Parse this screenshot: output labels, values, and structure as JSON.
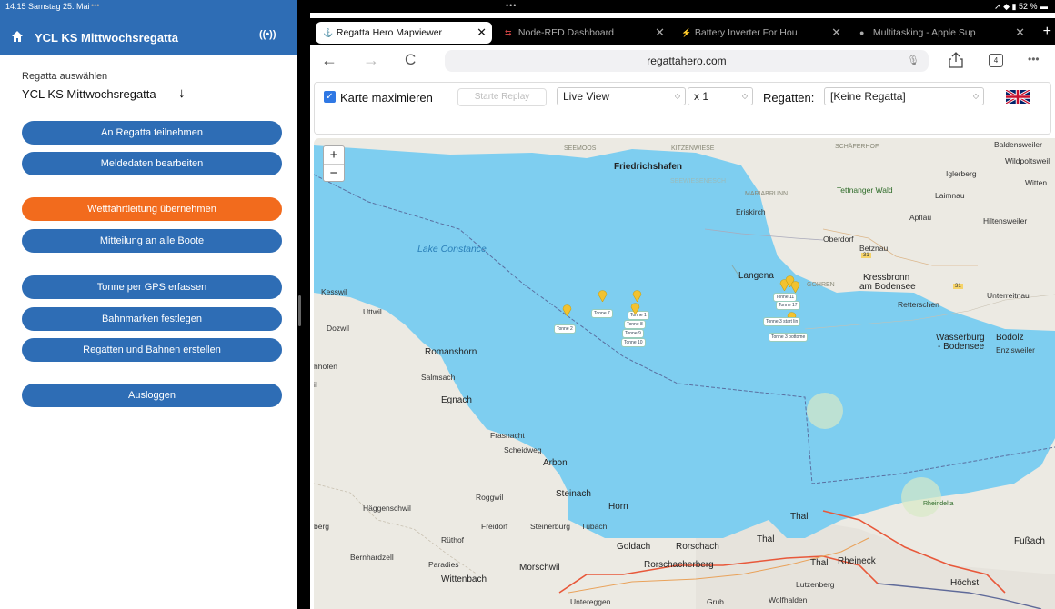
{
  "status": {
    "time_date": "14:15  Samstag 25. Mai",
    "dots": "•••",
    "center_dots": "•••",
    "right": "➚ ◆ ▮ 52 % ▬"
  },
  "left": {
    "title": "YCL KS Mittwochsregatta",
    "select_label": "Regatta auswählen",
    "select_value": "YCL KS Mittwochsregatta",
    "select_arrow": "↓",
    "buttons": {
      "join": "An Regatta teilnehmen",
      "edit": "Meldedaten bearbeiten",
      "race_office": "Wettfahrtleitung übernehmen",
      "message": "Mitteilung an alle Boote",
      "gps_buoy": "Tonne per GPS erfassen",
      "marks": "Bahnmarken festlegen",
      "create": "Regatten und Bahnen erstellen",
      "logout": "Ausloggen"
    }
  },
  "browser": {
    "tabs": [
      {
        "label": "Regatta Hero Mapviewer",
        "icon": "⚓"
      },
      {
        "label": "Node-RED Dashboard",
        "icon": "⇆"
      },
      {
        "label": "Battery Inverter For Hou",
        "icon": "⚡"
      },
      {
        "label": "Multitasking - Apple Sup",
        "icon": "●"
      }
    ],
    "plus": "+",
    "url": "regattahero.com",
    "tab_count": "4",
    "back": "←",
    "forward": "→",
    "reload": "C",
    "more": "•••"
  },
  "toolbar": {
    "maximize_label": "Karte maximieren",
    "replay": "Starte Replay",
    "view_value": "Live View",
    "speed_value": "x 1",
    "regatten_label": "Regatten:",
    "regatta_value": "[Keine Regatta]"
  },
  "map": {
    "zoom_in": "+",
    "zoom_out": "−",
    "labels": {
      "lake": "Lake Constance",
      "friedrichshafen": "Friedrichshafen",
      "seemoos": "SEEMOOS",
      "kitzenwiese": "KITZENWIESE",
      "schaferhof": "SCHÄFERHOF",
      "baldensweiler": "Baldensweiler",
      "wildpoltsweil": "Wildpoltsweil",
      "iglerberg": "Iglerberg",
      "witten": "Witten",
      "seewiesenesch": "SEEWIESENESCH",
      "mariabrunn": "MARIABRUNN",
      "tettnanger": "Tettnanger Wald",
      "laimnau": "Laimnau",
      "eriskirch": "Eriskirch",
      "apflau": "Apflau",
      "hiltensweiler": "Hiltensweiler",
      "oberdorf": "Oberdorf",
      "betznau": "Betznau",
      "langenargen": "Langena",
      "gohren": "GOHREN",
      "kressbronn": "Kressbronn",
      "am_bodensee": "am Bodensee",
      "unterreitnau": "Unterreitnau",
      "retterschen": "Retterschen",
      "kesswil": "Kesswil",
      "uttwil": "Uttwil",
      "dozwil": "Dozwil",
      "romanshorn": "Romanshorn",
      "hofen": "hhofen",
      "salmsach": "Salmsach",
      "egnach": "Egnach",
      "wasserburg": "Wasserburg",
      "bodenseelabel": "- Bodensee",
      "bodolz": "Bodolz",
      "enzisweiler": "Enzisweiler",
      "frasnacht": "Frasnacht",
      "scheidweg": "Scheidweg",
      "arbon": "Arbon",
      "roggwil": "Roggwil",
      "steinach": "Steinach",
      "horn": "Horn",
      "haggenschwil": "Häggenschwil",
      "freidorf": "Freidorf",
      "steinerburg": "Steinerburg",
      "tubach": "Tübach",
      "ruthof": "Rüthof",
      "goldach": "Goldach",
      "rorschach": "Rorschach",
      "thal": "Thal",
      "thal2": "Thal",
      "rheineck": "Rheineck",
      "bernhardzell": "Bernhardzell",
      "paradies": "Paradies",
      "morschwil": "Mörschwil",
      "wittenbach": "Wittenbach",
      "rorschacherberg": "Rorschacherberg",
      "lutzenberg": "Lutzenberg",
      "hochst": "Höchst",
      "fussach": "Fußach",
      "rheindelta": "Rheindelta",
      "untereggen": "Untereggen",
      "grub": "Grub",
      "wolfhalden": "Wolfhalden",
      "berg": "berg",
      "il": "il",
      "road31a": "31",
      "road31b": "31"
    },
    "buoys": {
      "t2": "Tonne 2",
      "t7": "Tonne 7",
      "t1": "Tonne 1",
      "t8": "Tonne 8",
      "t9": "Tonne 9",
      "t10": "Tonne 10",
      "t3start": "Tonne 3 start lin",
      "t3bottom": "Tonne 3 bottome",
      "t11": "Tonne 11",
      "t17": "Tonne 17"
    }
  }
}
